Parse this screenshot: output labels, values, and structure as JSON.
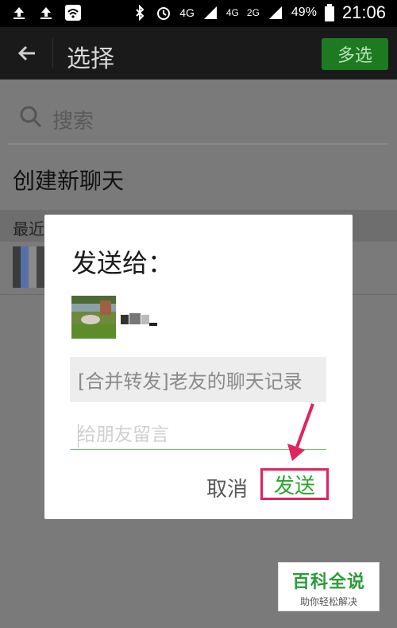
{
  "status_bar": {
    "time": "21:06",
    "battery": "49%",
    "network_1": "4G",
    "network_2": "4G",
    "network_3": "2G"
  },
  "header": {
    "title": "选择",
    "multi_select": "多选"
  },
  "search": {
    "placeholder": "搜索"
  },
  "list": {
    "new_chat": "创建新聊天",
    "recent_label": "最近"
  },
  "dialog": {
    "title": "发送给：",
    "preview": "[合并转发]老友的聊天记录",
    "message_placeholder": "给朋友留言",
    "cancel": "取消",
    "send": "发送"
  },
  "watermark": {
    "main": "百科全说",
    "sub": "助你轻松解决"
  },
  "colors": {
    "accent_green": "#1e7a21",
    "send_green": "#2aa52d",
    "highlight": "#e0245e"
  }
}
